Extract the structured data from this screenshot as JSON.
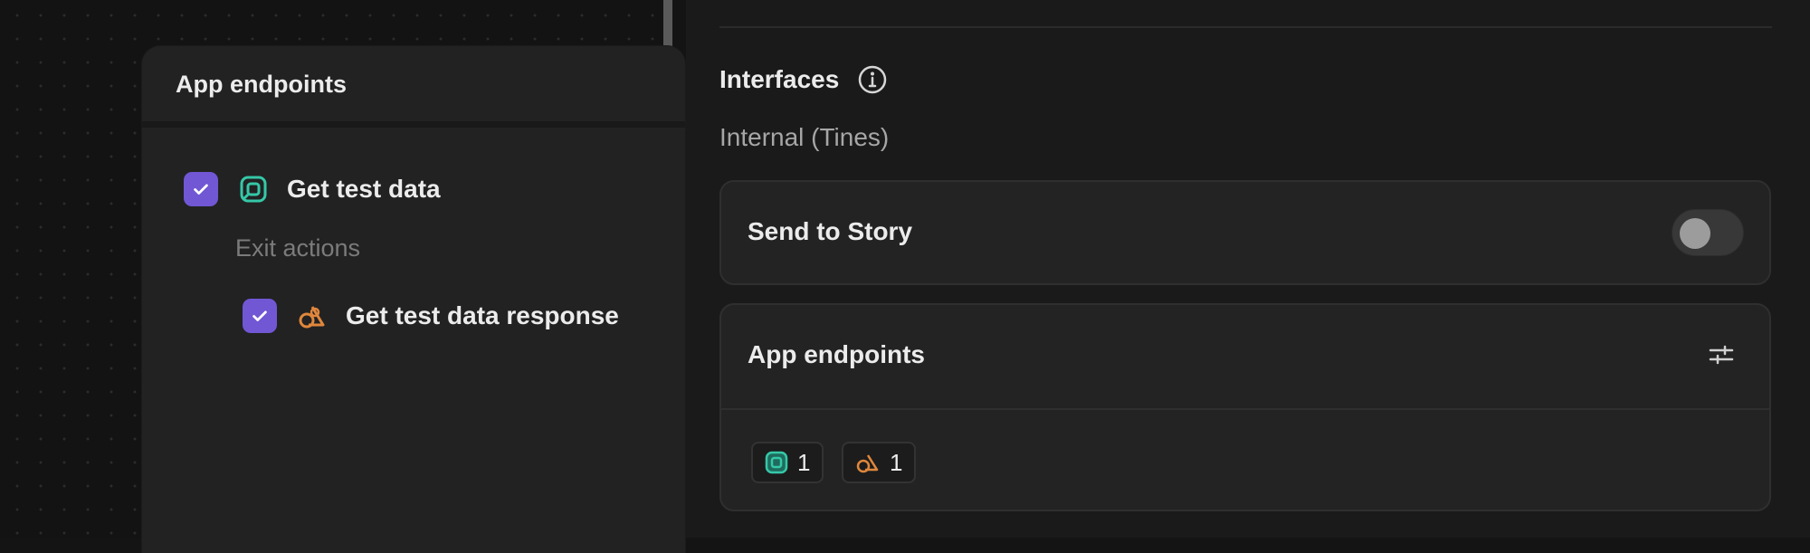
{
  "floating_panel": {
    "title": "App endpoints",
    "endpoints": [
      {
        "label": "Get test data",
        "checked": true,
        "icon": "webhook-icon"
      }
    ],
    "exit_section_label": "Exit actions",
    "exit_actions": [
      {
        "label": "Get test data response",
        "checked": true,
        "icon": "event-transform-icon"
      }
    ]
  },
  "interfaces": {
    "title": "Interfaces",
    "subtitle": "Internal (Tines)",
    "send_to_story": {
      "label": "Send to Story",
      "enabled": false
    },
    "app_endpoints_card": {
      "title": "App endpoints",
      "chips": [
        {
          "icon": "webhook-icon",
          "count": "1"
        },
        {
          "icon": "event-transform-icon",
          "count": "1"
        }
      ]
    }
  },
  "colors": {
    "checkbox": "#7157d4",
    "webhook_icon": "#35c8a8",
    "transform_icon": "#e0873c"
  }
}
